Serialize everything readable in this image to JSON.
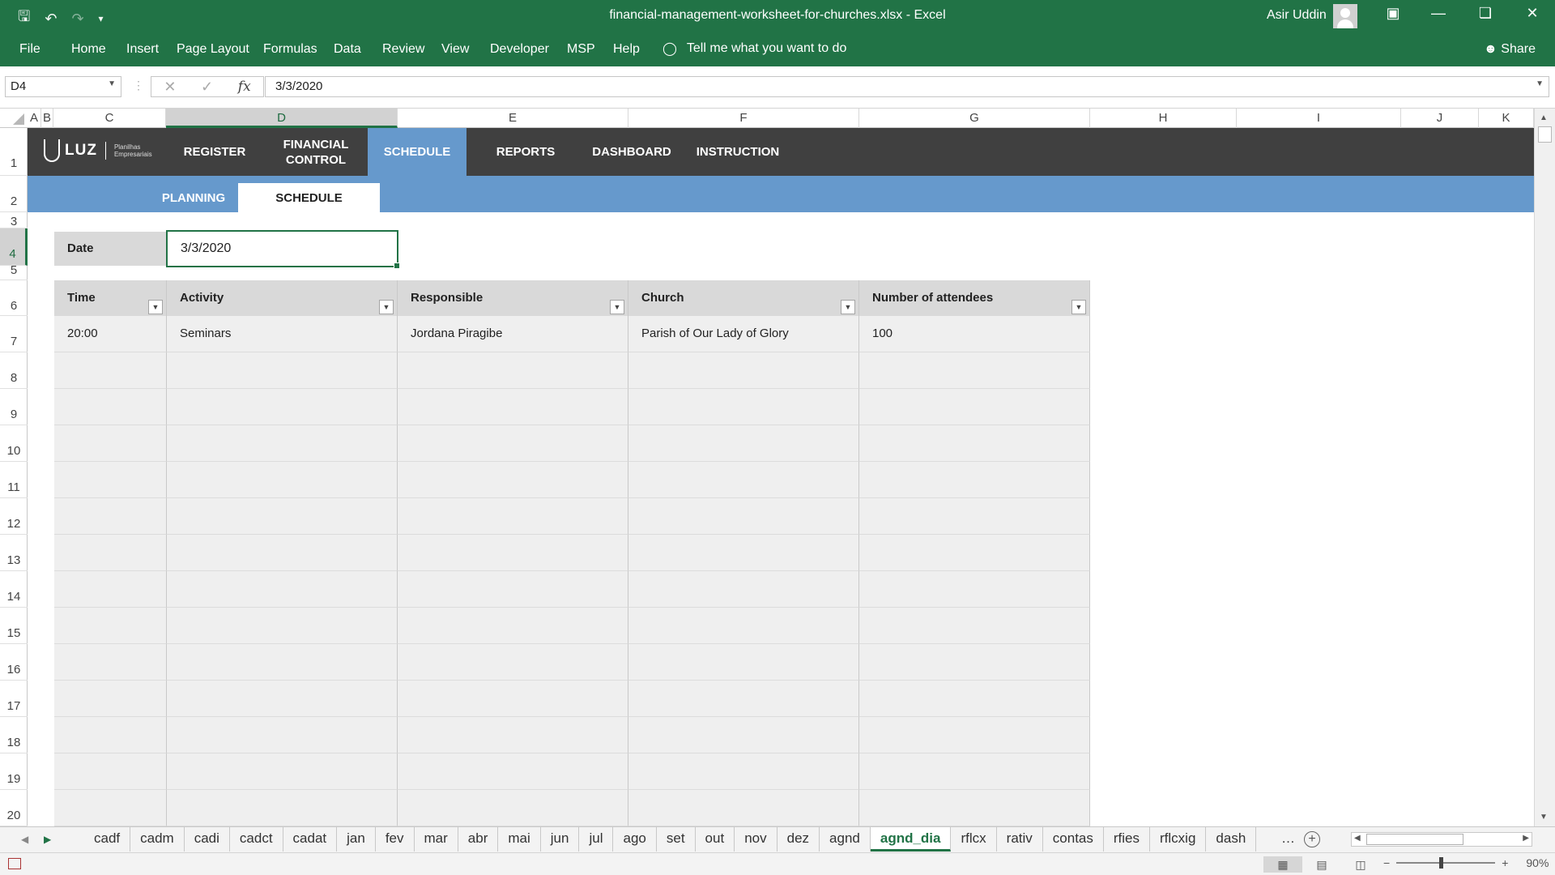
{
  "window": {
    "title": "financial-management-worksheet-for-churches.xlsx  -  Excel",
    "user": "Asir Uddin",
    "qat_icons": [
      "save-icon",
      "undo-icon",
      "redo-icon",
      "customize-icon"
    ]
  },
  "ribbon": {
    "tabs": [
      "File",
      "Home",
      "Insert",
      "Page Layout",
      "Formulas",
      "Data",
      "Review",
      "View",
      "Developer",
      "MSP",
      "Help"
    ],
    "tell_me": "Tell me what you want to do",
    "share": "Share"
  },
  "formula_bar": {
    "name_box": "D4",
    "fx": "fx",
    "value": "3/3/2020"
  },
  "columns": [
    "A",
    "B",
    "C",
    "D",
    "E",
    "F",
    "G",
    "H",
    "I",
    "J",
    "K"
  ],
  "selected_column": "D",
  "rows": [
    "1",
    "2",
    "3",
    "4",
    "5",
    "6",
    "7",
    "8",
    "9",
    "10",
    "11",
    "12",
    "13",
    "14",
    "15",
    "16",
    "17",
    "18",
    "19",
    "20"
  ],
  "selected_row": "4",
  "app_nav": {
    "logo_text": "LUZ",
    "logo_sub": [
      "Planilhas",
      "Empresariais"
    ],
    "items": [
      "REGISTER",
      "FINANCIAL CONTROL",
      "SCHEDULE",
      "REPORTS",
      "DASHBOARD",
      "INSTRUCTION"
    ],
    "active": "SCHEDULE"
  },
  "sub_nav": {
    "items": [
      "PLANNING",
      "SCHEDULE"
    ],
    "active": "SCHEDULE"
  },
  "date_field": {
    "label": "Date",
    "value": "3/3/2020"
  },
  "table": {
    "headers": [
      "Time",
      "Activity",
      "Responsible",
      "Church",
      "Number of attendees"
    ],
    "rows": [
      [
        "20:00",
        "Seminars",
        "Jordana Piragibe",
        "Parish of Our Lady of Glory",
        "100"
      ],
      [
        "",
        "",
        "",
        "",
        ""
      ],
      [
        "",
        "",
        "",
        "",
        ""
      ],
      [
        "",
        "",
        "",
        "",
        ""
      ],
      [
        "",
        "",
        "",
        "",
        ""
      ],
      [
        "",
        "",
        "",
        "",
        ""
      ],
      [
        "",
        "",
        "",
        "",
        ""
      ],
      [
        "",
        "",
        "",
        "",
        ""
      ],
      [
        "",
        "",
        "",
        "",
        ""
      ],
      [
        "",
        "",
        "",
        "",
        ""
      ],
      [
        "",
        "",
        "",
        "",
        ""
      ],
      [
        "",
        "",
        "",
        "",
        ""
      ],
      [
        "",
        "",
        "",
        "",
        ""
      ],
      [
        "",
        "",
        "",
        "",
        ""
      ]
    ]
  },
  "sheet_tabs": [
    "cadf",
    "cadm",
    "cadi",
    "cadct",
    "cadat",
    "jan",
    "fev",
    "mar",
    "abr",
    "mai",
    "jun",
    "jul",
    "ago",
    "set",
    "out",
    "nov",
    "dez",
    "agnd",
    "agnd_dia",
    "rflcx",
    "rativ",
    "contas",
    "rfies",
    "rflcxig",
    "dash"
  ],
  "active_sheet": "agnd_dia",
  "status": {
    "zoom": "90%",
    "zoom_fraction": 0.45
  },
  "colors": {
    "excel_green": "#217346",
    "nav_dark": "#404040",
    "nav_blue": "#6699cc"
  }
}
